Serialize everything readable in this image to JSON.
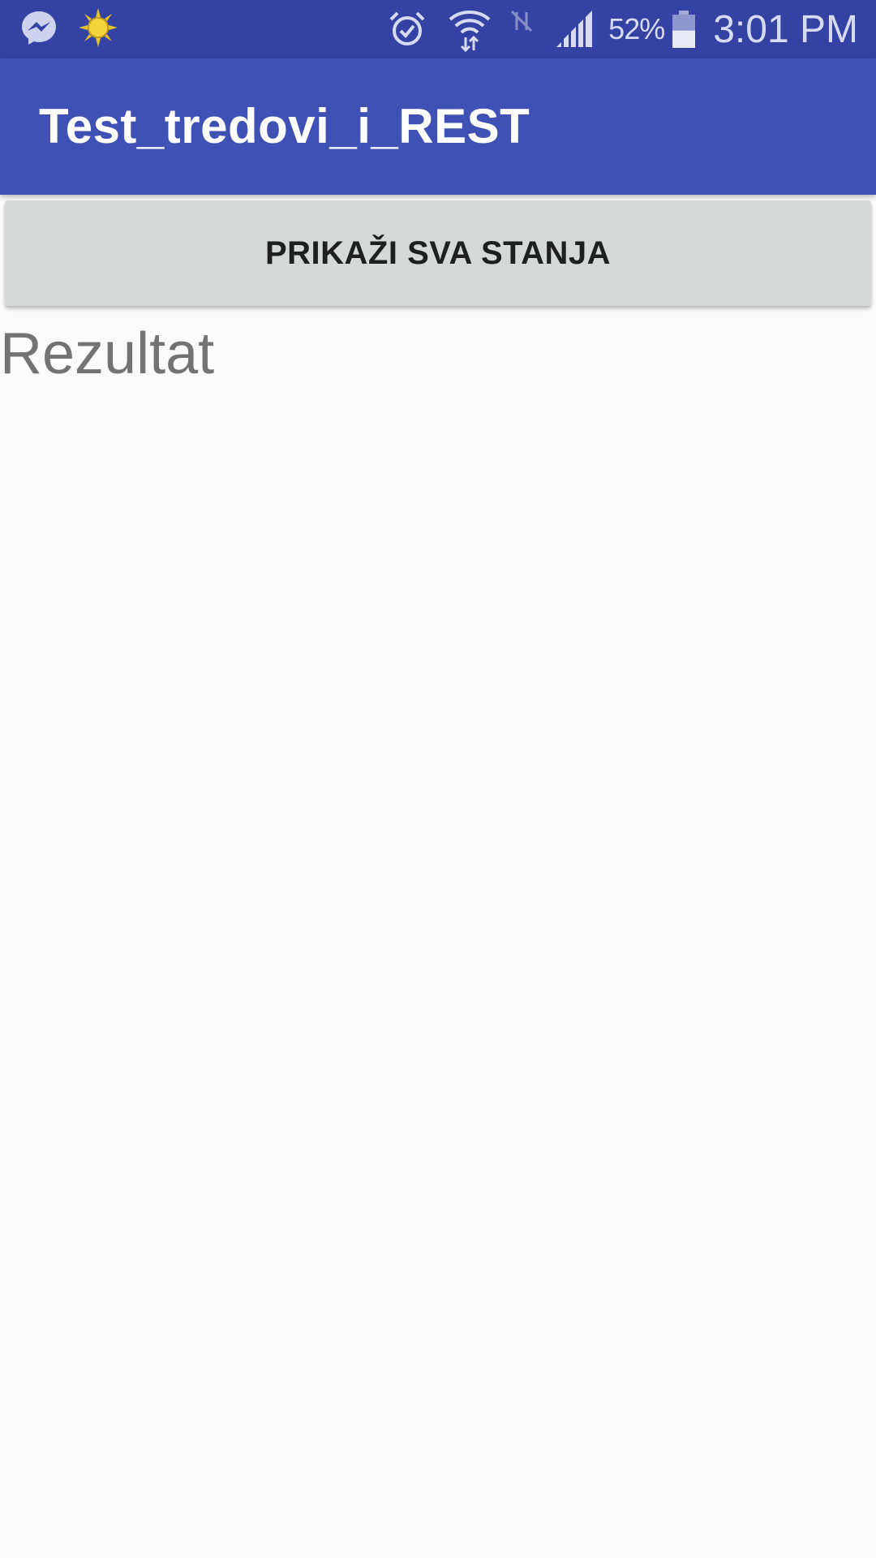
{
  "status_bar": {
    "left_icons": [
      "messenger-icon",
      "sun-icon"
    ],
    "right_icons": [
      "alarm-icon",
      "wifi-icon",
      "no-data-icon",
      "signal-icon",
      "battery-icon"
    ],
    "battery_percent": "52%",
    "battery_level": 0.52,
    "time": "3:01 PM",
    "color": "#3442a3"
  },
  "app_bar": {
    "title": "Test_tredovi_i_REST",
    "color": "#3f51b5"
  },
  "main": {
    "button_label": "PRIKAŽI SVA STANJA",
    "result_text": "Rezultat"
  }
}
